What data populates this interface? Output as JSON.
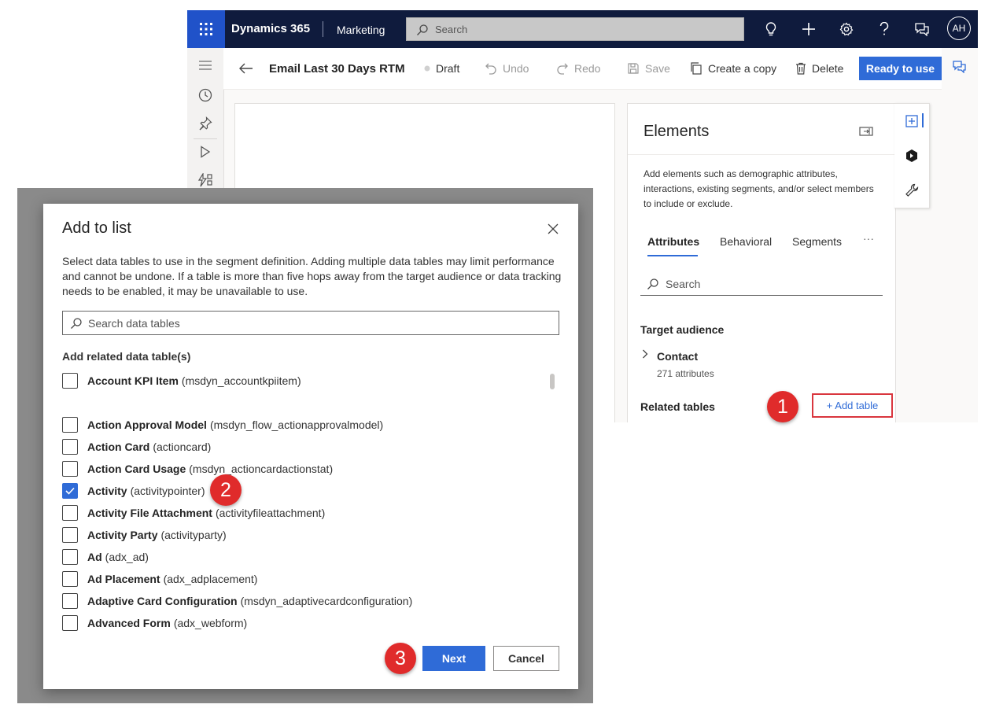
{
  "topbar": {
    "app_name": "Dynamics 365",
    "module": "Marketing",
    "search_placeholder": "Search",
    "avatar_initials": "AH"
  },
  "command_bar": {
    "record_title": "Email Last 30 Days RTM",
    "status": "Draft",
    "undo": "Undo",
    "redo": "Redo",
    "save": "Save",
    "create_copy": "Create a copy",
    "delete": "Delete",
    "ready": "Ready to use"
  },
  "elements_panel": {
    "title": "Elements",
    "description": "Add elements such as demographic attributes, interactions, existing segments, and/or select members to include or exclude.",
    "tabs": [
      "Attributes",
      "Behavioral",
      "Segments"
    ],
    "more": "···",
    "search_placeholder": "Search",
    "target_audience_label": "Target audience",
    "contact_name": "Contact",
    "contact_attributes": "271 attributes",
    "related_tables_label": "Related tables",
    "add_table": "+ Add table"
  },
  "dialog": {
    "title": "Add to list",
    "description": "Select data tables to use in the segment definition. Adding multiple data tables may limit performance and cannot be undone. If a table is more than five hops away from the target audience or data tracking needs to be enabled, it may be unavailable to use.",
    "search_placeholder": "Search data tables",
    "section_label": "Add related data table(s)",
    "items": [
      {
        "name": "Account KPI Item",
        "system": "(msdyn_accountkpiitem)",
        "checked": false
      },
      {
        "name": "Action Approval Model",
        "system": "(msdyn_flow_actionapprovalmodel)",
        "checked": false
      },
      {
        "name": "Action Card",
        "system": "(actioncard)",
        "checked": false
      },
      {
        "name": "Action Card Usage",
        "system": "(msdyn_actioncardactionstat)",
        "checked": false
      },
      {
        "name": "Activity",
        "system": "(activitypointer)",
        "checked": true
      },
      {
        "name": "Activity File Attachment",
        "system": "(activityfileattachment)",
        "checked": false
      },
      {
        "name": "Activity Party",
        "system": "(activityparty)",
        "checked": false
      },
      {
        "name": "Ad",
        "system": "(adx_ad)",
        "checked": false
      },
      {
        "name": "Ad Placement",
        "system": "(adx_adplacement)",
        "checked": false
      },
      {
        "name": "Adaptive Card Configuration",
        "system": "(msdyn_adaptivecardconfiguration)",
        "checked": false
      },
      {
        "name": "Advanced Form",
        "system": "(adx_webform)",
        "checked": false
      }
    ],
    "next": "Next",
    "cancel": "Cancel"
  },
  "callouts": [
    "1",
    "2",
    "3"
  ],
  "colors": {
    "topbar": "#0f1b3d",
    "waffle": "#2052c9",
    "accent": "#2f6bd7",
    "callout": "#e02b2b",
    "overlay": "#8a8a8a"
  }
}
